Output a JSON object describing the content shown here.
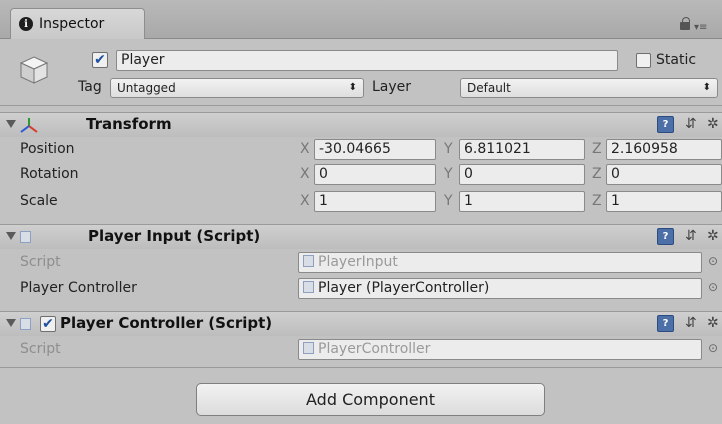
{
  "tab": {
    "label": "Inspector",
    "info_glyph": "i"
  },
  "window": {
    "menu_glyph": "▾≡"
  },
  "header": {
    "active": true,
    "name": "Player",
    "static_label": "Static",
    "static_checked": false,
    "tag_label": "Tag",
    "tag_value": "Untagged",
    "layer_label": "Layer",
    "layer_value": "Default",
    "dropdown_arrow": "⬍"
  },
  "transform": {
    "title": "Transform",
    "rows": [
      {
        "label": "Position",
        "x": "-30.04665",
        "y": "6.811021",
        "z": "2.160958"
      },
      {
        "label": "Rotation",
        "x": "0",
        "y": "0",
        "z": "0"
      },
      {
        "label": "Scale",
        "x": "1",
        "y": "1",
        "z": "1"
      }
    ],
    "axis": {
      "x": "X",
      "y": "Y",
      "z": "Z"
    }
  },
  "player_input": {
    "title": "Player Input (Script)",
    "script_label": "Script",
    "script_value": "PlayerInput",
    "controller_label": "Player Controller",
    "controller_value": "Player (PlayerController)"
  },
  "player_controller": {
    "title": "Player Controller (Script)",
    "enabled": true,
    "script_label": "Script",
    "script_value": "PlayerController"
  },
  "add_component_label": "Add Component",
  "icons": {
    "help": "?",
    "settings": "⇵",
    "gear": "✲",
    "object_picker": "⊙"
  },
  "colors": {
    "background": "#c2c2c2",
    "checkbox_blue": "#1b4fa0"
  }
}
